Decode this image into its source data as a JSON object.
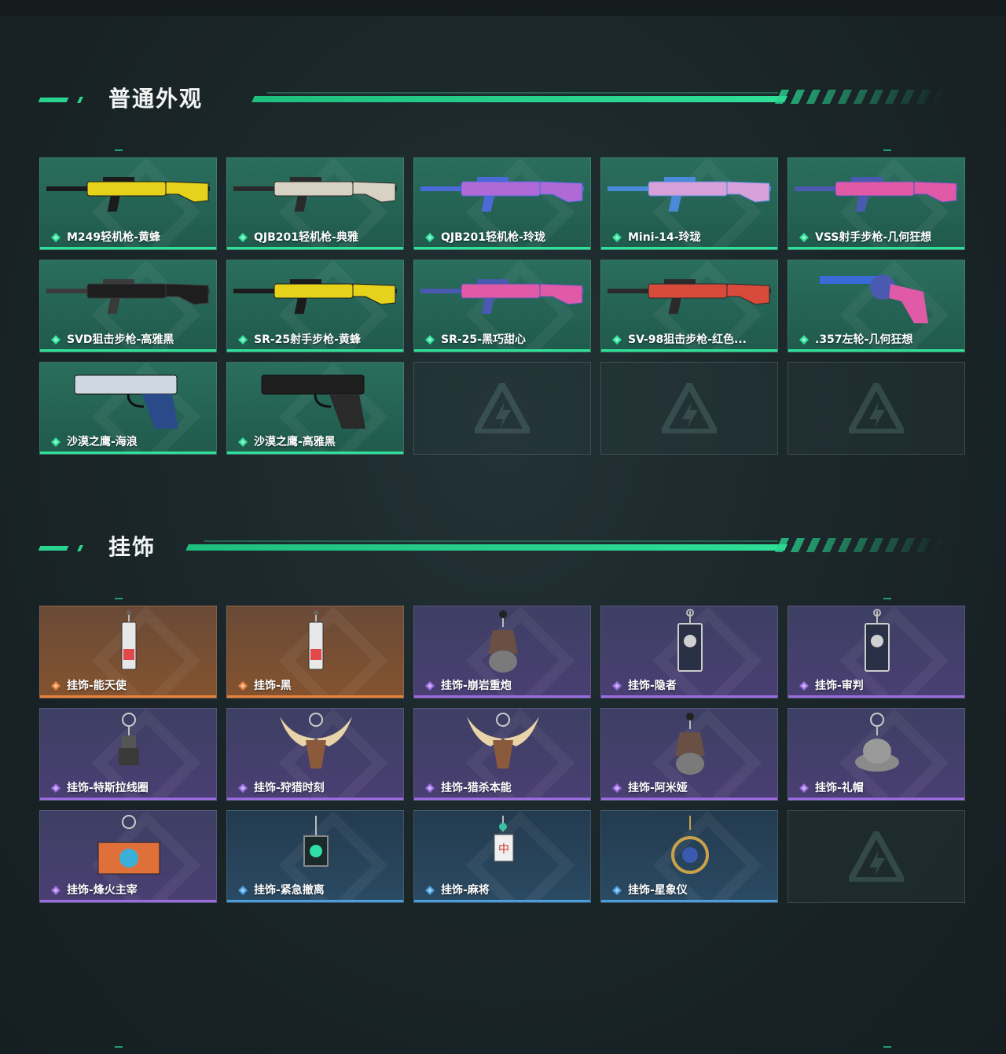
{
  "sections": [
    {
      "title": "普通外观",
      "items": [
        {
          "label": "M249轻机枪-黄蜂",
          "rarity": "green",
          "art": "rifle-yellow-icon"
        },
        {
          "label": "QJB201轻机枪-典雅",
          "rarity": "green",
          "art": "rifle-white-icon"
        },
        {
          "label": "QJB201轻机枪-玲珑",
          "rarity": "green",
          "art": "rifle-purple-icon"
        },
        {
          "label": "Mini-14-玲珑",
          "rarity": "green",
          "art": "rifle-pastel-icon"
        },
        {
          "label": "VSS射手步枪-几何狂想",
          "rarity": "green",
          "art": "rifle-pink-icon"
        },
        {
          "label": "SVD狙击步枪-高雅黑",
          "rarity": "green",
          "art": "rifle-black-icon"
        },
        {
          "label": "SR-25射手步枪-黄蜂",
          "rarity": "green",
          "art": "rifle-yellow-icon"
        },
        {
          "label": "SR-25-黑巧甜心",
          "rarity": "green",
          "art": "rifle-pink-icon"
        },
        {
          "label": "SV-98狙击步枪-红色...",
          "rarity": "green",
          "art": "rifle-red-icon"
        },
        {
          "label": ".357左轮-几何狂想",
          "rarity": "green",
          "art": "revolver-icon"
        },
        {
          "label": "沙漠之鹰-海浪",
          "rarity": "green",
          "art": "pistol-blue-icon"
        },
        {
          "label": "沙漠之鹰-高雅黑",
          "rarity": "green",
          "art": "pistol-black-icon"
        },
        {
          "label": "",
          "rarity": "empty"
        },
        {
          "label": "",
          "rarity": "empty"
        },
        {
          "label": "",
          "rarity": "empty"
        }
      ]
    },
    {
      "title": "挂饰",
      "items": [
        {
          "label": "挂饰-能天使",
          "rarity": "orange",
          "art": "charm-tag-icon"
        },
        {
          "label": "挂饰-黑",
          "rarity": "orange",
          "art": "charm-tag-icon"
        },
        {
          "label": "挂饰-崩岩重炮",
          "rarity": "purple",
          "art": "charm-figure-icon"
        },
        {
          "label": "挂饰-隐者",
          "rarity": "purple",
          "art": "charm-card-icon"
        },
        {
          "label": "挂饰-审判",
          "rarity": "purple",
          "art": "charm-card-icon"
        },
        {
          "label": "挂饰-特斯拉线圈",
          "rarity": "purple",
          "art": "charm-coil-icon"
        },
        {
          "label": "挂饰-狩猎时刻",
          "rarity": "purple",
          "art": "charm-antler-icon"
        },
        {
          "label": "挂饰-猎杀本能",
          "rarity": "purple",
          "art": "charm-antler-icon"
        },
        {
          "label": "挂饰-阿米娅",
          "rarity": "purple",
          "art": "charm-figure-icon"
        },
        {
          "label": "挂饰-礼帽",
          "rarity": "purple",
          "art": "charm-hat-icon"
        },
        {
          "label": "挂饰-烽火主宰",
          "rarity": "purple",
          "art": "charm-container-icon"
        },
        {
          "label": "挂饰-紧急撤离",
          "rarity": "blue",
          "art": "charm-plate-icon"
        },
        {
          "label": "挂饰-麻将",
          "rarity": "blue",
          "art": "charm-mahjong-icon"
        },
        {
          "label": "挂饰-星象仪",
          "rarity": "blue",
          "art": "charm-astrolabe-icon"
        },
        {
          "label": "",
          "rarity": "empty"
        }
      ]
    }
  ],
  "colors": {
    "accent": "#2ee098",
    "green": "#2ee098",
    "orange": "#e8823a",
    "purple": "#9a6ce0",
    "blue": "#4a9ee0"
  }
}
